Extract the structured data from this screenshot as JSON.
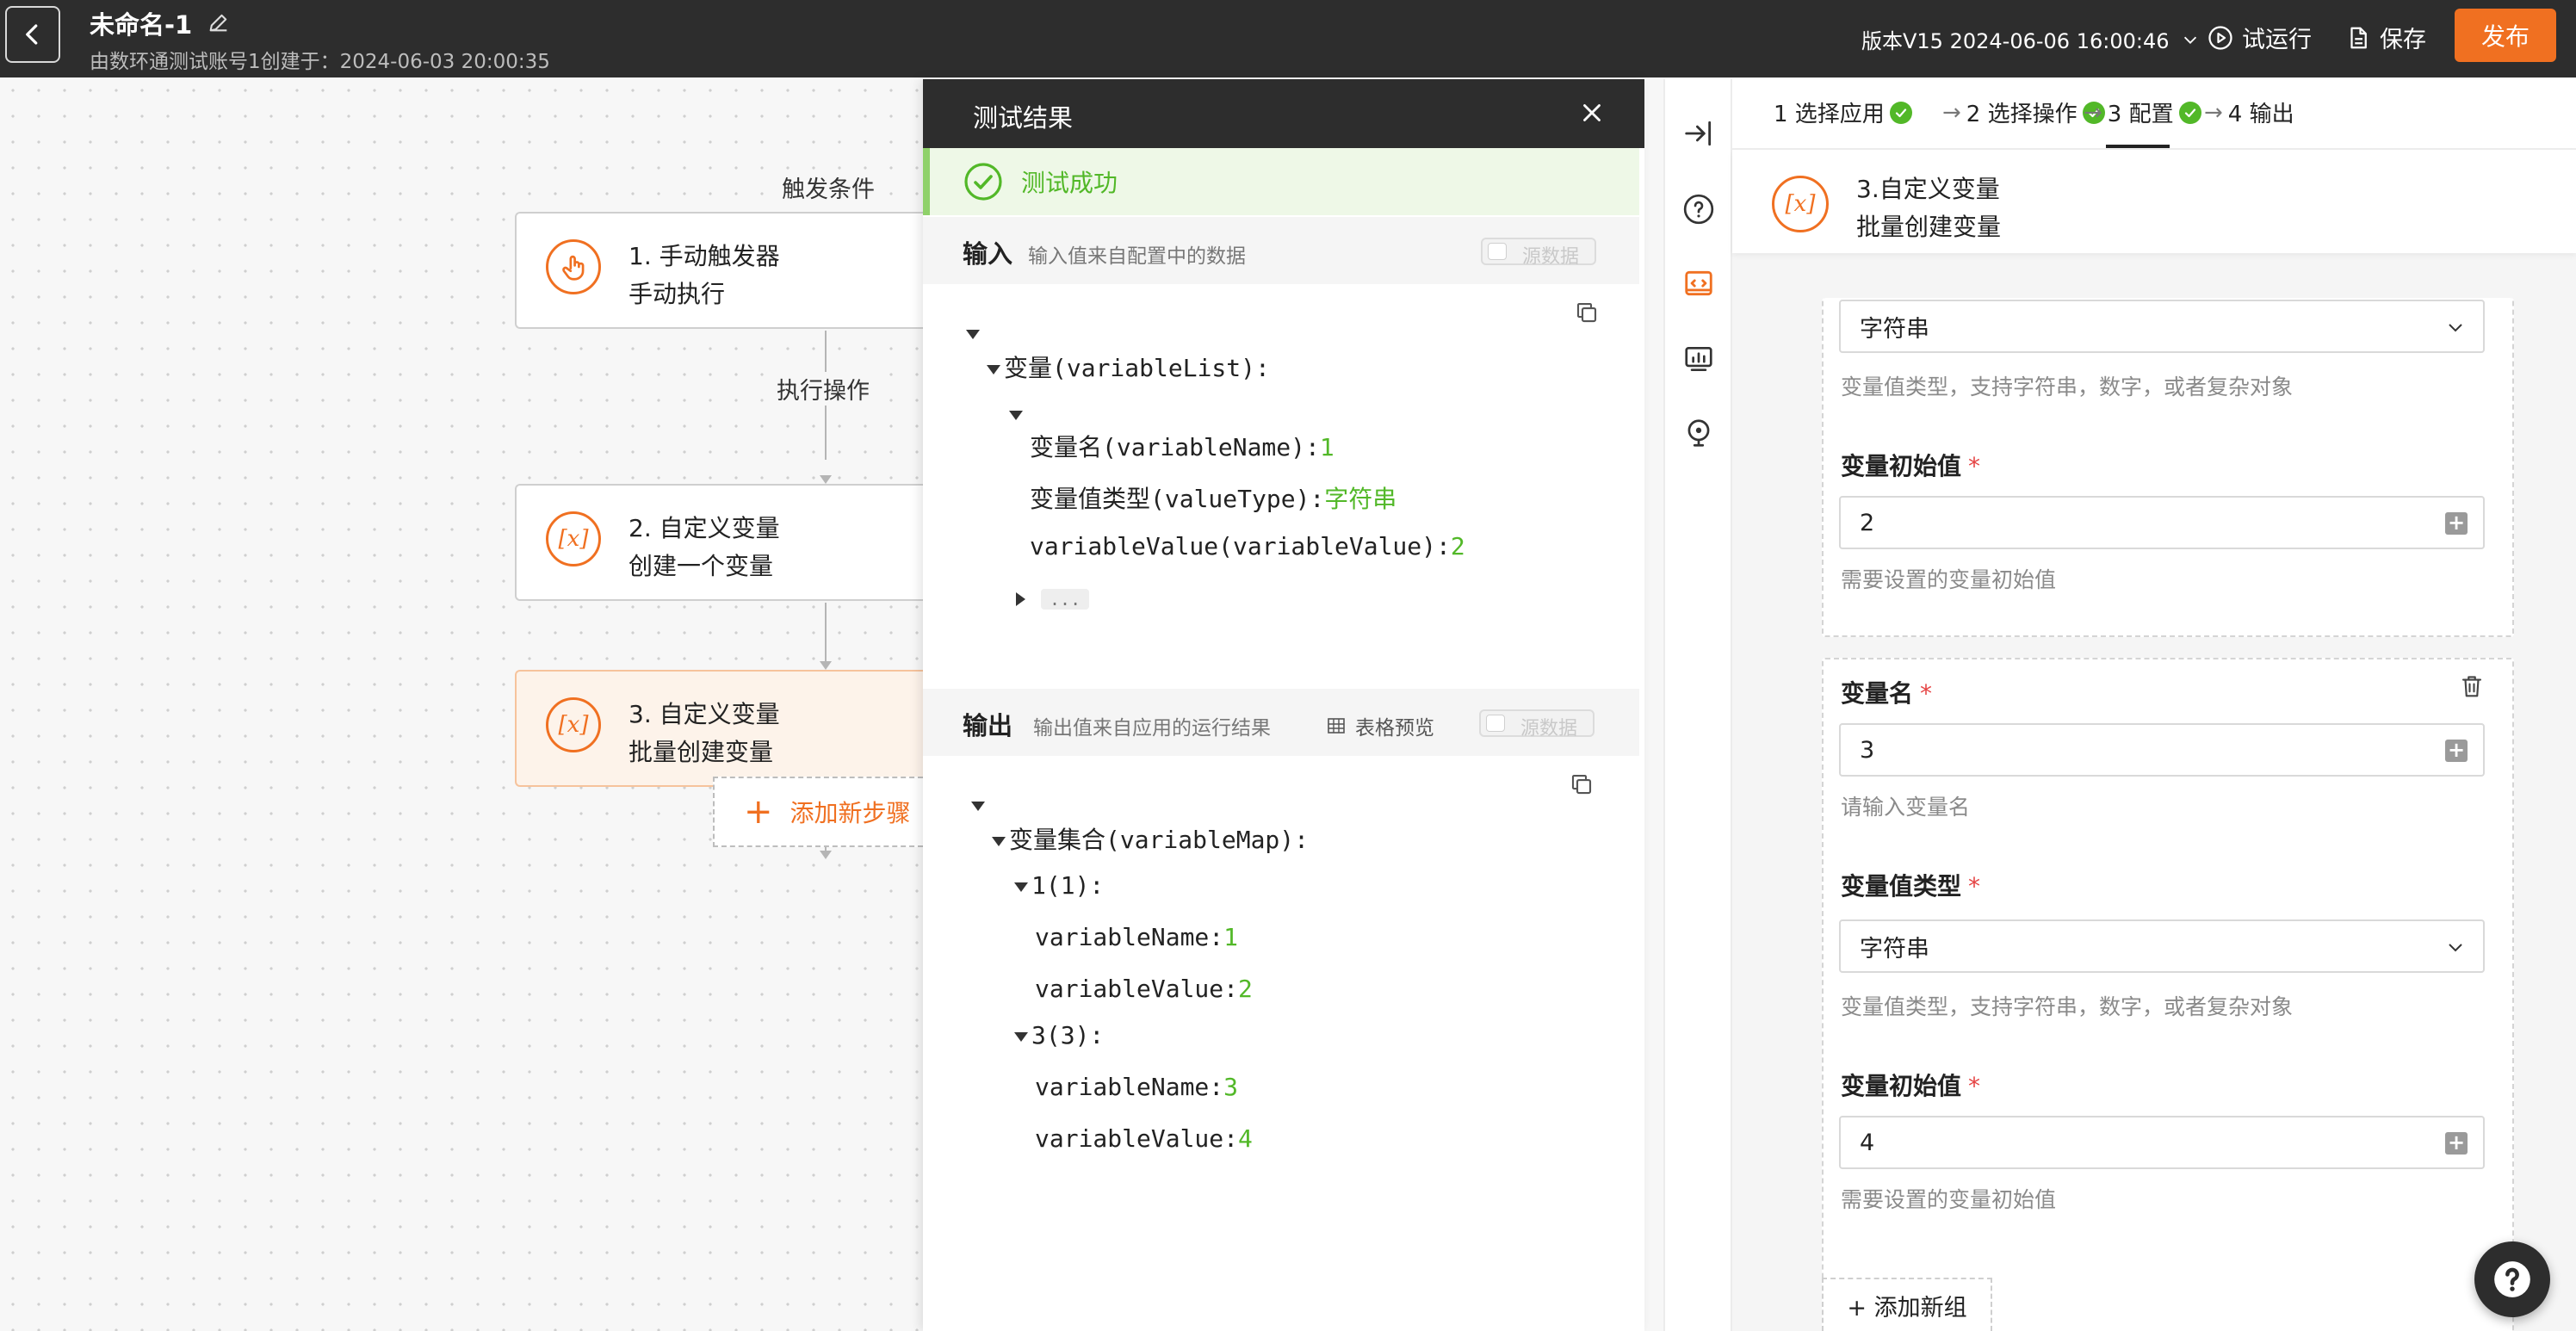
{
  "topbar": {
    "title": "未命名-1",
    "subtitle": "由数环通测试账号1创建于：2024-06-03 20:00:35",
    "version": "版本V15 2024-06-06 16:00:46",
    "trial_run": "试运行",
    "save": "保存",
    "publish": "发布"
  },
  "canvas": {
    "trigger_label": "触发条件",
    "action_label": "执行操作",
    "nodes": [
      {
        "title": "1. 手动触发器",
        "sub": "手动执行"
      },
      {
        "title": "2. 自定义变量",
        "sub": "创建一个变量"
      },
      {
        "title": "3. 自定义变量",
        "sub": "批量创建变量"
      }
    ],
    "add_step": "添加新步骤"
  },
  "result": {
    "title": "测试结果",
    "success": "测试成功",
    "input": {
      "label": "输入",
      "desc": "输入值来自配置中的数据",
      "toggle": "源数据",
      "root_key": "变量(variableList):",
      "fields": [
        {
          "key": "变量名(variableName):",
          "value": "1"
        },
        {
          "key": "变量值类型(valueType):",
          "value": "字符串"
        },
        {
          "key": "variableValue(variableValue):",
          "value": "2"
        }
      ],
      "more": "..."
    },
    "output": {
      "label": "输出",
      "desc": "输出值来自应用的运行结果",
      "table_preview": "表格预览",
      "toggle": "源数据",
      "root_key": "变量集合(variableMap):",
      "groups": [
        {
          "key": "1(1):",
          "name_key": "variableName:",
          "name_val": "1",
          "value_key": "variableValue:",
          "value_val": "2"
        },
        {
          "key": "3(3):",
          "name_key": "variableName:",
          "name_val": "3",
          "value_key": "variableValue:",
          "value_val": "4"
        }
      ]
    }
  },
  "config": {
    "steps": [
      {
        "label": "1 选择应用"
      },
      {
        "label": "2 选择操作"
      },
      {
        "label": "3 配置"
      },
      {
        "label": "4 输出"
      }
    ],
    "step_title": "3.自定义变量",
    "step_sub": "批量创建变量",
    "group1": {
      "type_value": "字符串",
      "type_help": "变量值类型，支持字符串，数字，或者复杂对象",
      "init_label": "变量初始值",
      "init_value": "2",
      "init_help": "需要设置的变量初始值"
    },
    "group2": {
      "name_label": "变量名",
      "name_value": "3",
      "name_help": "请输入变量名",
      "type_label": "变量值类型",
      "type_value": "字符串",
      "type_help": "变量值类型，支持字符串，数字，或者复杂对象",
      "init_label": "变量初始值",
      "init_value": "4",
      "init_help": "需要设置的变量初始值"
    },
    "add_group": "+ 添加新组",
    "required_mark": "*"
  },
  "colors": {
    "accent": "#f07021",
    "success": "#52b828",
    "topbar": "#2d2d2d"
  }
}
